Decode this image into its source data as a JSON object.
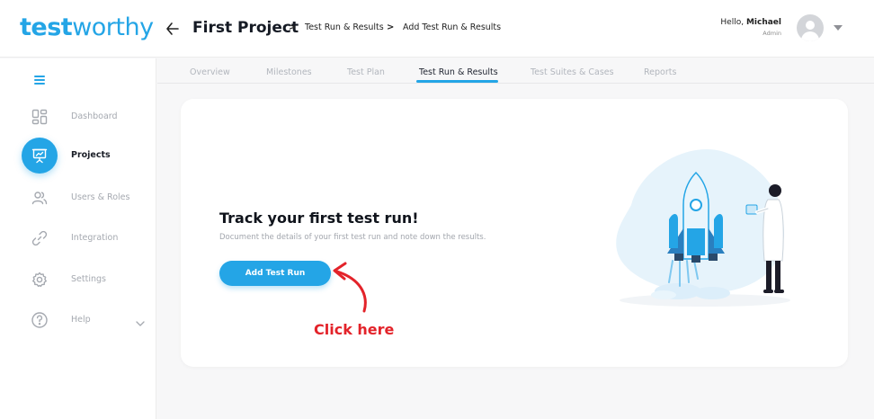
{
  "app": {
    "logo_bold": "test",
    "logo_light": "worthy",
    "brand_color": "#24a5e6"
  },
  "header": {
    "back_icon": "arrow-left-icon",
    "project_title": "First Project",
    "breadcrumb": [
      "Test Run & Results",
      "Add Test Run & Results"
    ],
    "breadcrumb_separator": ">",
    "greeting_prefix": "Hello, ",
    "user_name": "Michael",
    "user_role": "Admin"
  },
  "sidebar": {
    "menu_icon": "hamburger-icon",
    "items": [
      {
        "label": "Dashboard",
        "icon": "dashboard-icon",
        "active": false
      },
      {
        "label": "Projects",
        "icon": "presentation-icon",
        "active": true
      },
      {
        "label": "Users & Roles",
        "icon": "users-icon",
        "active": false
      },
      {
        "label": "Integration",
        "icon": "link-icon",
        "active": false
      },
      {
        "label": "Settings",
        "icon": "gear-icon",
        "active": false
      },
      {
        "label": "Help",
        "icon": "help-icon",
        "active": false
      }
    ]
  },
  "tabs": [
    {
      "label": "Overview",
      "active": false
    },
    {
      "label": "Milestones",
      "active": false
    },
    {
      "label": "Test Plan",
      "active": false
    },
    {
      "label": "Test Run & Results",
      "active": true
    },
    {
      "label": "Test Suites & Cases",
      "active": false
    },
    {
      "label": "Reports",
      "active": false
    }
  ],
  "empty_state": {
    "title": "Track your first test run!",
    "subtitle": "Document the details of your first test run and note down the results.",
    "button_label": "Add Test Run",
    "annotation": "Click here",
    "annotation_color": "#e3232a",
    "illustration": "rocket-launch-scientist-illustration"
  }
}
